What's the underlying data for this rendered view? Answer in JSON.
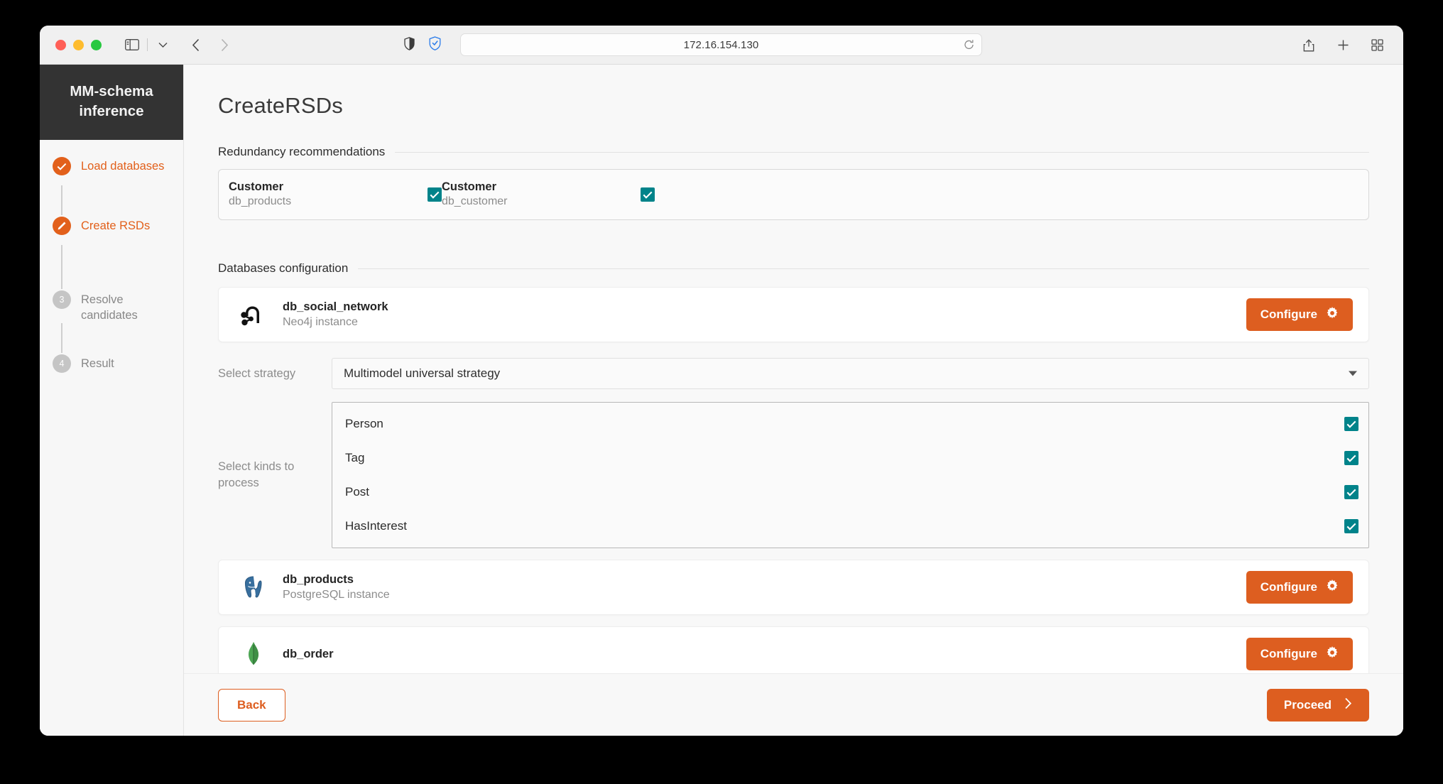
{
  "browser": {
    "url": "172.16.154.130",
    "icons": {
      "sidebar_toggle": "sidebar-toggle-icon",
      "chevron_down": "chevron-down-icon",
      "back": "nav-back-icon",
      "forward": "nav-forward-icon",
      "privacy_report": "privacy-report-icon",
      "shield_check": "shield-check-icon",
      "reload": "reload-icon",
      "share": "share-icon",
      "new_tab": "plus-icon",
      "tab_overview": "tab-overview-icon"
    }
  },
  "sidebar": {
    "brand_line1": "MM-schema",
    "brand_line2": "inference",
    "items": [
      {
        "label": "Load databases",
        "marker": "✓",
        "state": "done"
      },
      {
        "label": "Create RSDs",
        "marker": "✎",
        "state": "current"
      },
      {
        "label": "Resolve candidates",
        "marker": "3",
        "state": "todo"
      },
      {
        "label": "Result",
        "marker": "4",
        "state": "todo"
      }
    ]
  },
  "main": {
    "page_title": "CreateRSDs",
    "redundancy": {
      "section_title": "Redundancy recommendations",
      "items": [
        {
          "name": "Customer",
          "database": "db_products",
          "checked": true
        },
        {
          "name": "Customer",
          "database": "db_customer",
          "checked": true
        }
      ]
    },
    "databases": {
      "section_title": "Databases configuration",
      "rows": [
        {
          "name": "db_social_network",
          "subtitle": "Neo4j instance",
          "logo": "neo4j-logo",
          "configure_label": "Configure"
        },
        {
          "name": "db_products",
          "subtitle": "PostgreSQL instance",
          "logo": "postgresql-logo",
          "configure_label": "Configure"
        },
        {
          "name": "db_order",
          "subtitle": "",
          "logo": "mongodb-logo",
          "configure_label": "Configure"
        }
      ]
    },
    "strategy": {
      "label": "Select strategy",
      "value": "Multimodel universal strategy"
    },
    "kinds": {
      "label": "Select kinds to process",
      "items": [
        {
          "label": "Person",
          "checked": true
        },
        {
          "label": "Tag",
          "checked": true
        },
        {
          "label": "Post",
          "checked": true
        },
        {
          "label": "HasInterest",
          "checked": true
        }
      ]
    }
  },
  "footer": {
    "back_label": "Back",
    "proceed_label": "Proceed"
  },
  "colors": {
    "accent_orange": "#dd5e20",
    "checkbox_teal": "#00838a",
    "sidebar_dark": "#333333",
    "step_todo_grey": "#c5c5c5"
  }
}
